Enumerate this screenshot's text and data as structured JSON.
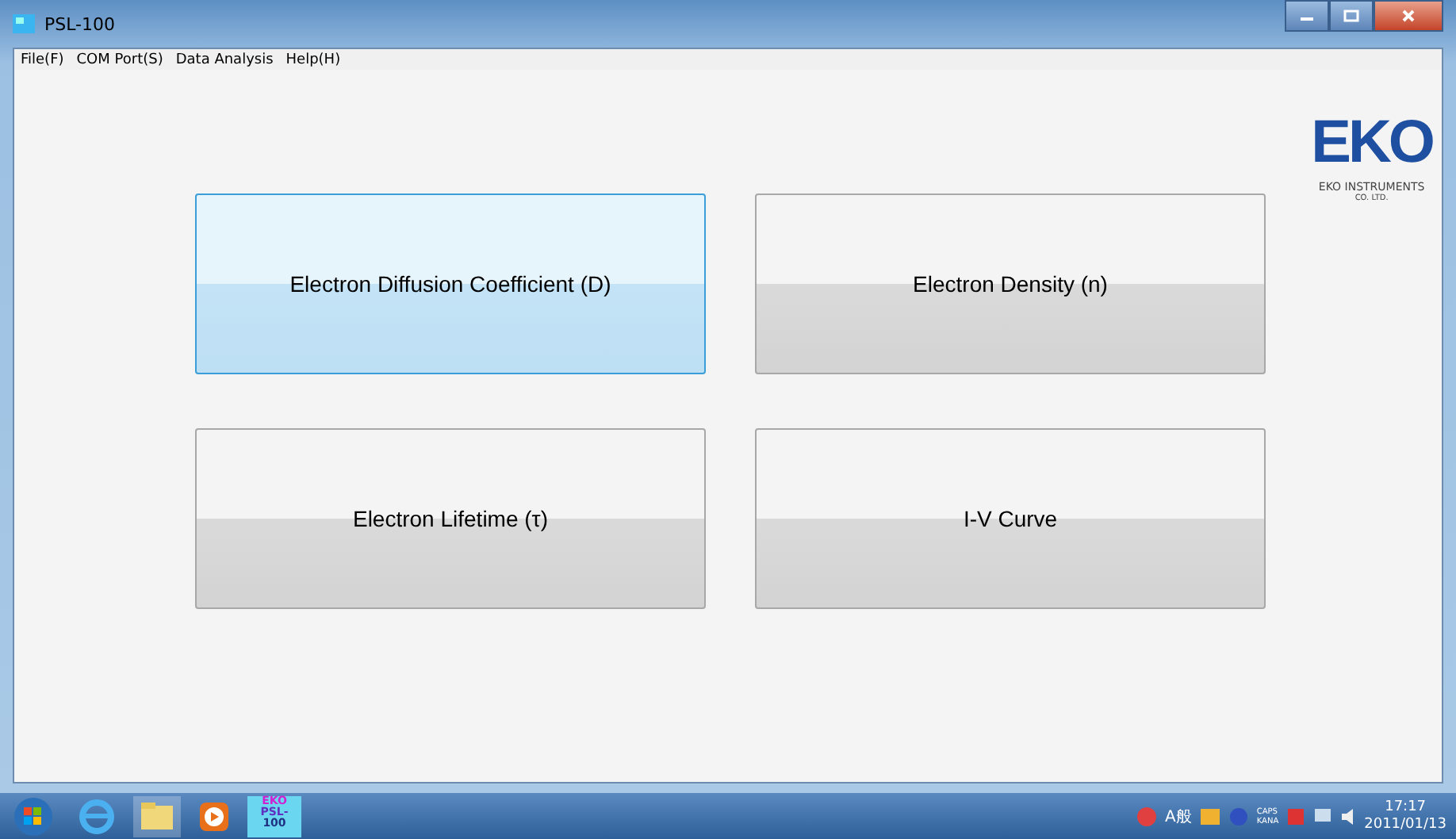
{
  "window": {
    "title": "PSL-100"
  },
  "menu": [
    "File(F)",
    "COM Port(S)",
    "Data Analysis",
    "Help(H)"
  ],
  "logo": {
    "mark": "EKO",
    "company": "EKO INSTRUMENTS",
    "suffix": "CO. LTD."
  },
  "buttons": [
    {
      "label": "Electron Diffusion Coefficient (D)",
      "selected": true
    },
    {
      "label": "Electron Density (n)",
      "selected": false
    },
    {
      "label": "Electron Lifetime (τ)",
      "selected": false
    },
    {
      "label": "I-V Curve",
      "selected": false
    }
  ],
  "taskbar": {
    "app_icon": {
      "line_1": "EKO",
      "line_2": "PSL-",
      "line_3": "100"
    },
    "ime": "A般",
    "caps": "CAPS",
    "kana": "KANA",
    "time": "17:17",
    "date": "2011/01/13"
  }
}
